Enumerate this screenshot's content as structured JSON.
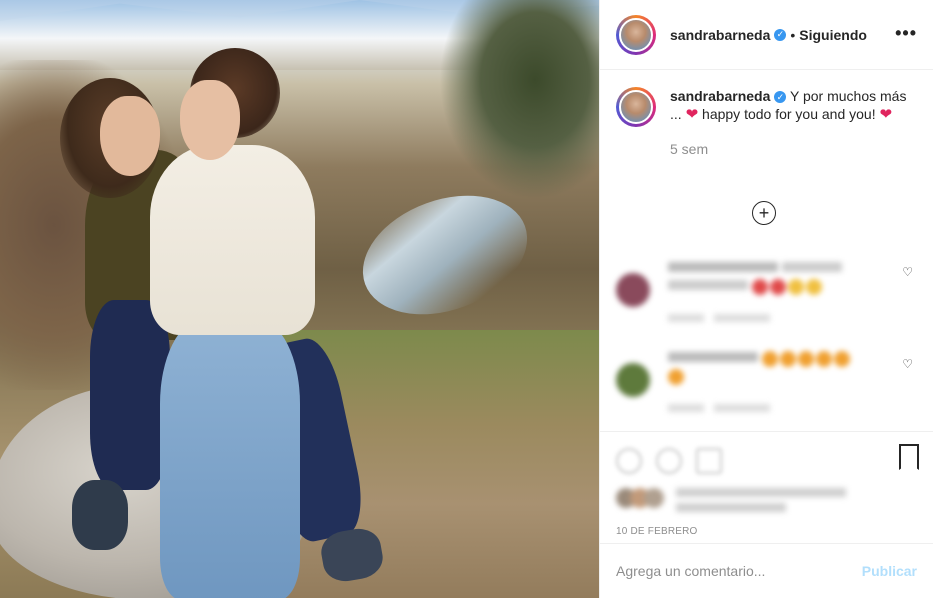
{
  "post": {
    "username": "sandrabarneda",
    "verified_badge": "✓",
    "separator": "•",
    "follow_status": "Siguiendo",
    "more_options": "•••"
  },
  "caption": {
    "username": "sandrabarneda",
    "text_part1": " Y por muchos más ... ",
    "heart": "❤",
    "text_part2": " happy todo for you and you! ",
    "time": "5 sem"
  },
  "load_more_label": "+",
  "comments_blurred": [
    {
      "text": "",
      "time": "",
      "reply_label": "",
      "avatar_color": "#8a4a5c"
    },
    {
      "text": "",
      "time": "",
      "reply_label": "",
      "avatar_color": "#5e7a3c"
    }
  ],
  "likes": {
    "text": ""
  },
  "date": "10 DE FEBRERO",
  "add_comment": {
    "placeholder": "Agrega un comentario...",
    "publish_label": "Publicar"
  },
  "colors": {
    "verified": "#3897f0",
    "publish_disabled": "#b2dffc",
    "heart": "#e0245e"
  },
  "icons": [
    "heart-icon",
    "comment-icon",
    "share-icon",
    "bookmark-icon",
    "more-icon",
    "plus-circle-icon",
    "verified-badge-icon"
  ]
}
